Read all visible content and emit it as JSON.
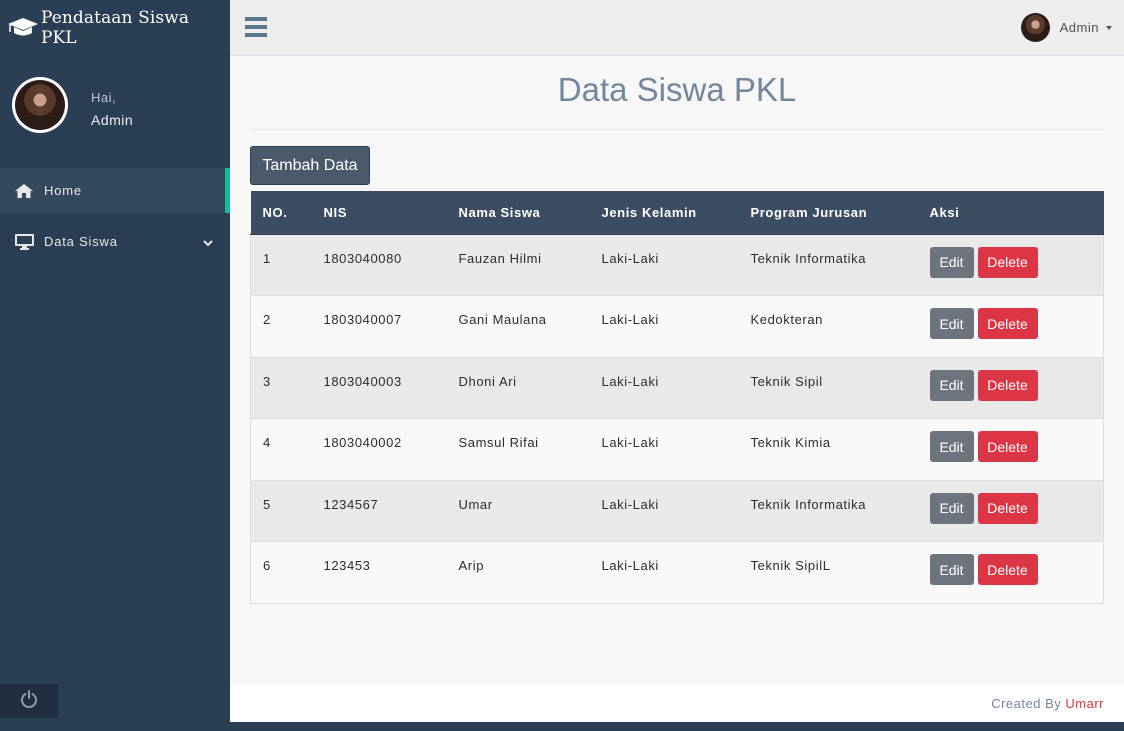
{
  "app": {
    "title": "Pendataan Siswa PKL"
  },
  "sidebar": {
    "greeting": "Hai,",
    "user_name": "Admin",
    "items": [
      {
        "label": "Home",
        "icon": "home-icon",
        "active": true
      },
      {
        "label": "Data Siswa",
        "icon": "desktop-icon",
        "active": false
      }
    ]
  },
  "topbar": {
    "user_name": "Admin"
  },
  "main": {
    "title": "Data Siswa PKL",
    "add_button": "Tambah Data",
    "table": {
      "headers": [
        "NO.",
        "NIS",
        "Nama Siswa",
        "Jenis Kelamin",
        "Program Jurusan",
        "Aksi"
      ],
      "rows": [
        {
          "no": "1",
          "nis": "1803040080",
          "nama": "Fauzan Hilmi",
          "jk": "Laki-Laki",
          "jurusan": "Teknik Informatika"
        },
        {
          "no": "2",
          "nis": "1803040007",
          "nama": "Gani Maulana",
          "jk": "Laki-Laki",
          "jurusan": "Kedokteran"
        },
        {
          "no": "3",
          "nis": "1803040003",
          "nama": "Dhoni Ari",
          "jk": "Laki-Laki",
          "jurusan": "Teknik Sipil"
        },
        {
          "no": "4",
          "nis": "1803040002",
          "nama": "Samsul Rifai",
          "jk": "Laki-Laki",
          "jurusan": "Teknik Kimia"
        },
        {
          "no": "5",
          "nis": "1234567",
          "nama": "Umar",
          "jk": "Laki-Laki",
          "jurusan": "Teknik Informatika"
        },
        {
          "no": "6",
          "nis": "123453",
          "nama": "Arip",
          "jk": "Laki-Laki",
          "jurusan": "Teknik SipilL"
        }
      ],
      "edit_label": "Edit",
      "delete_label": "Delete"
    }
  },
  "footer": {
    "prefix": "Created By",
    "author": "Umarr"
  },
  "colors": {
    "sidebar": "#2a3f54",
    "accent": "#1abb9c",
    "danger": "#dc3545",
    "secondary": "#6c757d",
    "header": "#3b4d61"
  }
}
